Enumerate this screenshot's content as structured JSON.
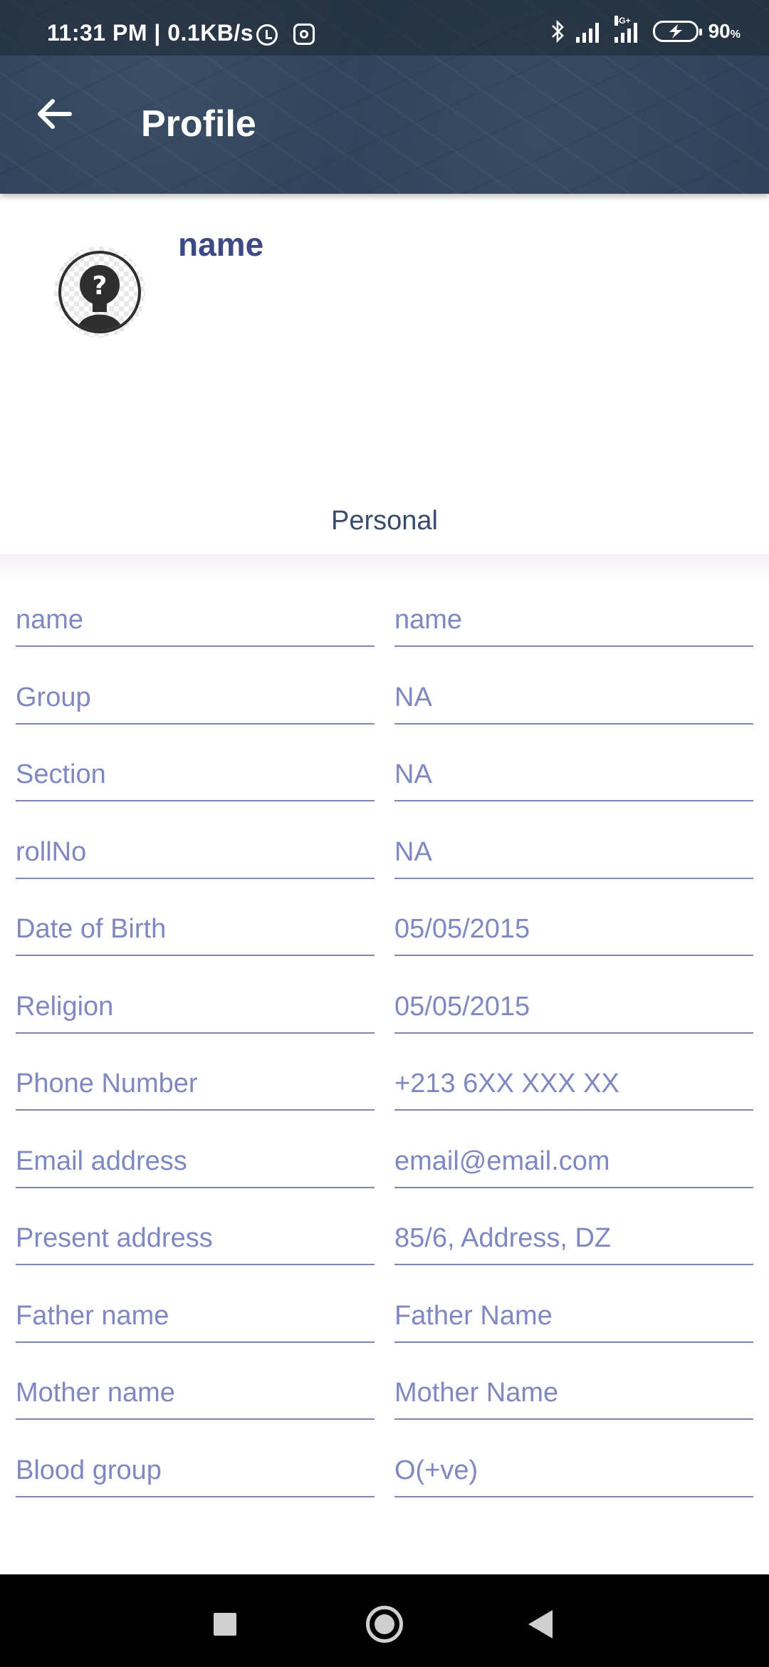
{
  "status_bar": {
    "time_speed": "11:31 PM | 0.1KB/s",
    "network_label": "4G+",
    "battery_percent": "90",
    "battery_unit": "%",
    "icons": [
      "alarm-icon",
      "instagram-icon",
      "bluetooth-icon",
      "signal-icon",
      "signal-4g-icon",
      "battery-charging-icon"
    ]
  },
  "app_bar": {
    "title": "Profile",
    "back_icon": "arrow-left-icon"
  },
  "profile": {
    "name": "name",
    "avatar_icon": "unknown-person-icon"
  },
  "tabs": {
    "personal": "Personal"
  },
  "fields": [
    {
      "label": "name",
      "value": "name"
    },
    {
      "label": "Group",
      "value": "NA"
    },
    {
      "label": "Section",
      "value": "NA"
    },
    {
      "label": "rollNo",
      "value": "NA"
    },
    {
      "label": "Date of Birth",
      "value": "05/05/2015"
    },
    {
      "label": "Religion",
      "value": "05/05/2015"
    },
    {
      "label": "Phone Number",
      "value": "+213 6XX XXX XX"
    },
    {
      "label": "Email address",
      "value": "email@email.com"
    },
    {
      "label": "Present address",
      "value": "85/6, Address, DZ"
    },
    {
      "label": "Father name",
      "value": "Father Name"
    },
    {
      "label": "Mother name",
      "value": "Mother Name"
    },
    {
      "label": "Blood group",
      "value": "O(+ve)"
    }
  ],
  "nav_bar": {
    "icons": [
      "recents-square-icon",
      "home-circle-icon",
      "back-triangle-icon"
    ]
  },
  "colors": {
    "header": "#2f445c",
    "accent_text": "#3d4a86",
    "field_text": "#8088c2",
    "underline": "#7e86b3"
  }
}
